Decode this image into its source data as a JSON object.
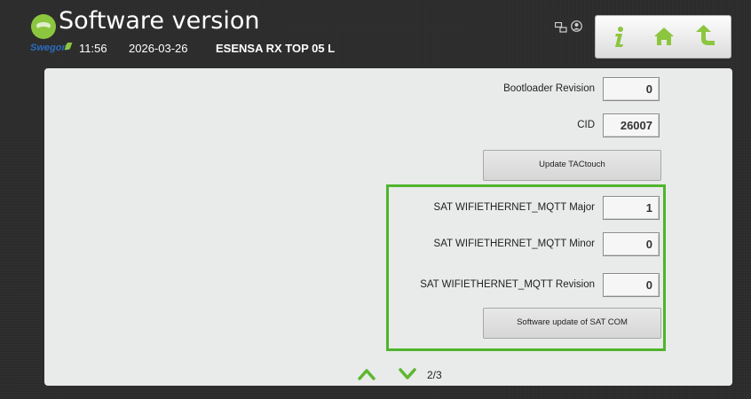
{
  "header": {
    "title": "Software version",
    "brand": "Swegon",
    "time": "11:56",
    "date": "2026-03-26",
    "unit_name": "ESENSA RX TOP 05 L",
    "icons": [
      "network-icon",
      "user-icon",
      "info-icon",
      "home-icon",
      "back-icon"
    ]
  },
  "rows": {
    "bootloader": {
      "label": "Bootloader Revision",
      "value": "0"
    },
    "cid": {
      "label": "CID",
      "value": "26007"
    },
    "update_button": "Update TACtouch",
    "sat_major": {
      "label": "SAT WIFIETHERNET_MQTT Major",
      "value": "1"
    },
    "sat_minor": {
      "label": "SAT WIFIETHERNET_MQTT Minor",
      "value": "0"
    },
    "sat_revision": {
      "label": "SAT WIFIETHERNET_MQTT Revision",
      "value": "0"
    },
    "sat_update_button": "Software update of SAT COM"
  },
  "pager": {
    "indicator": "2/3"
  },
  "colors": {
    "accent_green": "#4fb52c",
    "brand_blue": "#2a6cc0",
    "logo_green": "#8cc63f"
  }
}
